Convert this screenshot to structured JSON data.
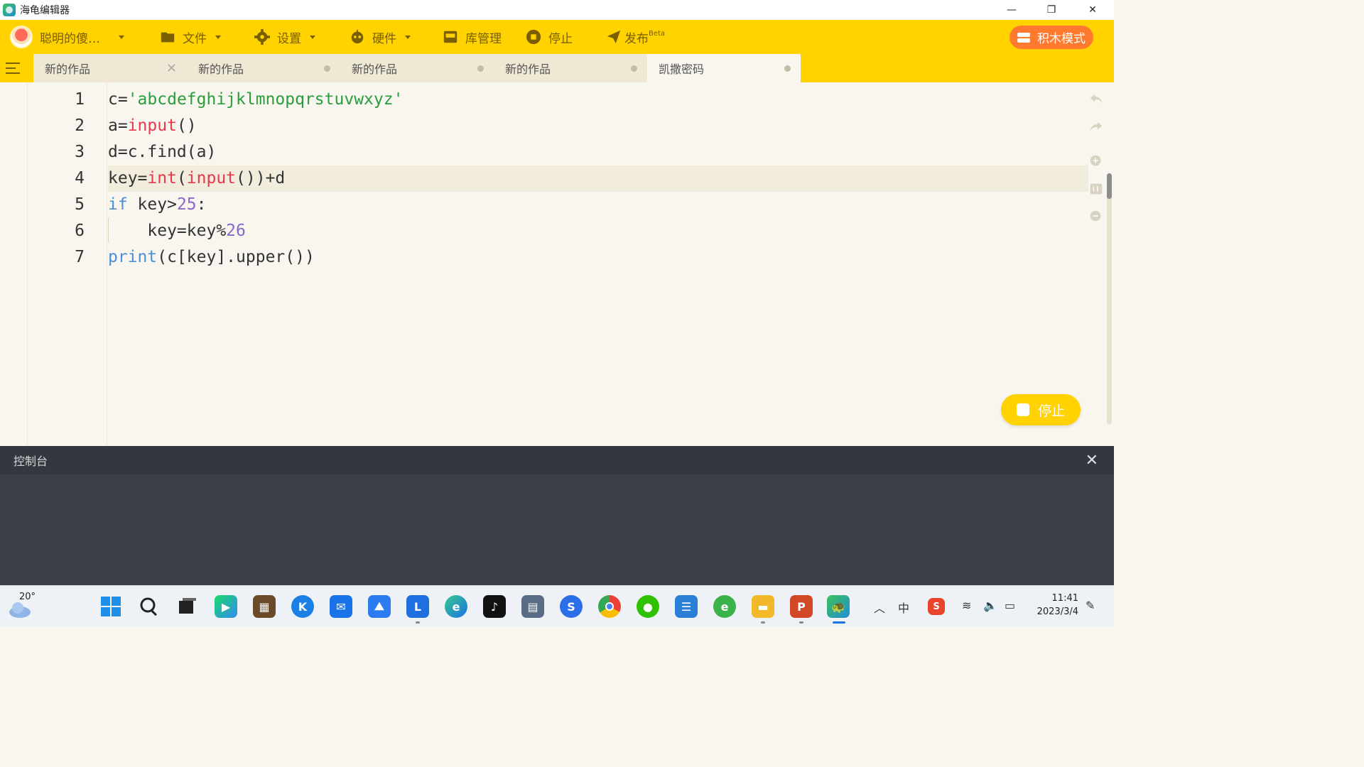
{
  "window": {
    "title": "海龟编辑器",
    "controls": {
      "minimize": "—",
      "maximize": "❐",
      "close": "✕"
    }
  },
  "menubar": {
    "user": "聪明的傻…",
    "file": "文件",
    "settings": "设置",
    "hardware": "硬件",
    "library": "库管理",
    "stop": "停止",
    "publish": "发布",
    "publish_badge": "Beta",
    "blocks_mode": "积木模式"
  },
  "tabs": [
    {
      "label": "新的作品",
      "close": "✕"
    },
    {
      "label": "新的作品"
    },
    {
      "label": "新的作品"
    },
    {
      "label": "新的作品"
    },
    {
      "label": "凯撒密码",
      "active": true
    }
  ],
  "editor": {
    "line_numbers": [
      "1",
      "2",
      "3",
      "4",
      "5",
      "6",
      "7"
    ],
    "lines": [
      [
        {
          "t": "c="
        },
        {
          "t": "'abcdefghijklmnopqrstuvwxyz'",
          "c": "str"
        }
      ],
      [
        {
          "t": "a="
        },
        {
          "t": "input",
          "c": "bi"
        },
        {
          "t": "()"
        }
      ],
      [
        {
          "t": "d=c.find(a)"
        }
      ],
      [
        {
          "t": "key="
        },
        {
          "t": "int",
          "c": "bi"
        },
        {
          "t": "("
        },
        {
          "t": "input",
          "c": "bi"
        },
        {
          "t": "())+d"
        }
      ],
      [
        {
          "t": "if",
          "c": "kw"
        },
        {
          "t": " key>"
        },
        {
          "t": "25",
          "c": "num"
        },
        {
          "t": ":"
        }
      ],
      [
        {
          "t": "    key=key%"
        },
        {
          "t": "26",
          "c": "num"
        }
      ],
      [
        {
          "t": "print",
          "c": "kw"
        },
        {
          "t": "(c[key].upper())"
        }
      ]
    ],
    "highlighted_line": 4,
    "stop_button": "停止"
  },
  "console": {
    "title": "控制台",
    "close": "✕"
  },
  "taskbar": {
    "weather_temp": "20°",
    "tray_ime": "中",
    "time": "11:41",
    "date": "2023/3/4"
  },
  "colors": {
    "accent": "#ffd200",
    "orange": "#ff7a2e",
    "console": "#3d4048"
  }
}
